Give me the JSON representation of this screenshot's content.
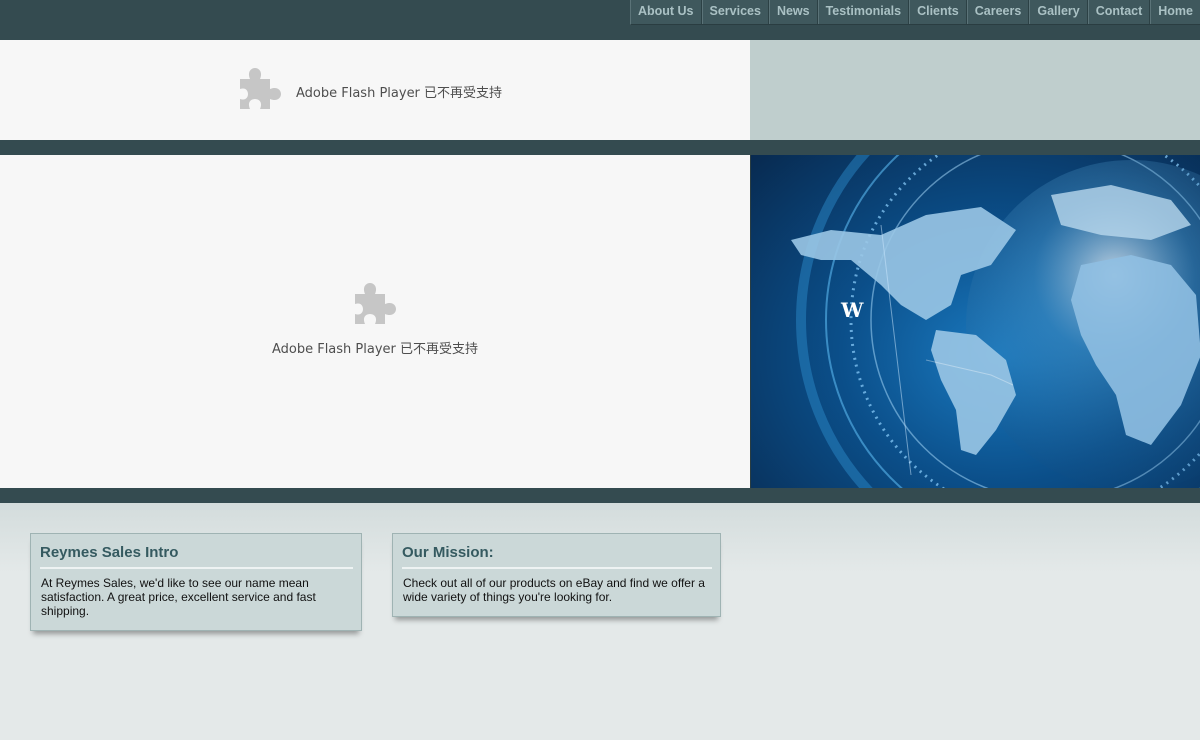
{
  "nav": {
    "items": [
      {
        "label": "About Us",
        "name": "nav-about-us"
      },
      {
        "label": "Services",
        "name": "nav-services"
      },
      {
        "label": "News",
        "name": "nav-news"
      },
      {
        "label": "Testimonials",
        "name": "nav-testimonials"
      },
      {
        "label": "Clients",
        "name": "nav-clients"
      },
      {
        "label": "Careers",
        "name": "nav-careers"
      },
      {
        "label": "Gallery",
        "name": "nav-gallery"
      },
      {
        "label": "Contact",
        "name": "nav-contact"
      },
      {
        "label": "Home",
        "name": "nav-home"
      }
    ]
  },
  "plugin_banner_top": {
    "icon": "puzzle-piece-icon",
    "message": "Adobe Flash Player 已不再受支持"
  },
  "plugin_banner_main": {
    "icon": "puzzle-piece-icon",
    "message": "Adobe Flash Player 已不再受支持"
  },
  "globe": {
    "compass_letter": "W"
  },
  "cards": {
    "intro": {
      "title": "Reymes Sales Intro",
      "body": "At Reymes Sales, we'd like to see our name mean satisfaction. A great price, excellent service and fast shipping."
    },
    "mission": {
      "title": "Our Mission:",
      "body": "Check out all of our products on eBay and find we offer a wide variety of things you're looking for."
    }
  },
  "colors": {
    "header_bar": "#344b50",
    "nav_text": "#aac1c4",
    "card_title": "#355a60",
    "card_background": "#cbd8d8"
  }
}
